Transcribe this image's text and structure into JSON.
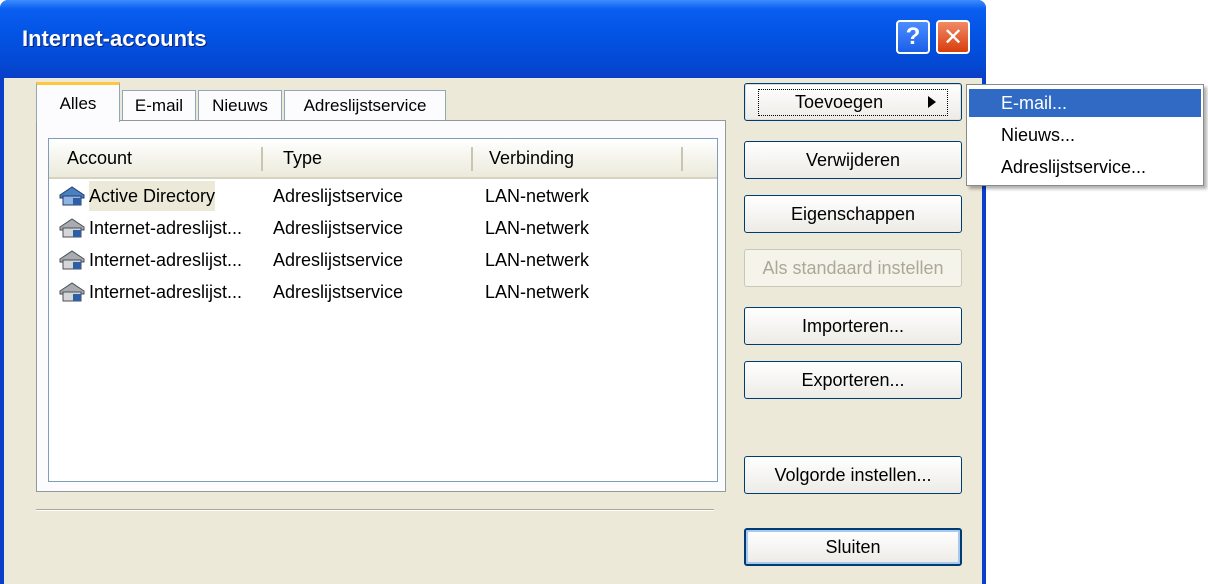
{
  "window": {
    "title": "Internet-accounts",
    "help_glyph": "?",
    "close_glyph": "✕"
  },
  "tabs": [
    {
      "label": "Alles",
      "active": true
    },
    {
      "label": "E-mail",
      "active": false
    },
    {
      "label": "Nieuws",
      "active": false
    },
    {
      "label": "Adreslijstservice",
      "active": false
    }
  ],
  "list": {
    "columns": [
      "Account",
      "Type",
      "Verbinding"
    ],
    "rows": [
      {
        "account": "Active Directory",
        "type": "Adreslijstservice",
        "connection": "LAN-netwerk",
        "icon": "directory-icon"
      },
      {
        "account": "Internet-adreslijst...",
        "type": "Adreslijstservice",
        "connection": "LAN-netwerk",
        "icon": "directory-icon"
      },
      {
        "account": "Internet-adreslijst...",
        "type": "Adreslijstservice",
        "connection": "LAN-netwerk",
        "icon": "directory-icon"
      },
      {
        "account": "Internet-adreslijst...",
        "type": "Adreslijstservice",
        "connection": "LAN-netwerk",
        "icon": "directory-icon"
      }
    ]
  },
  "buttons": {
    "add": "Toevoegen",
    "remove": "Verwijderen",
    "properties": "Eigenschappen",
    "set_default": "Als standaard instellen",
    "import": "Importeren...",
    "export": "Exporteren...",
    "order": "Volgorde instellen...",
    "close": "Sluiten"
  },
  "submenu": [
    "E-mail...",
    "Nieuws...",
    "Adreslijstservice..."
  ],
  "colors": {
    "title_bar": "#0355e6",
    "face": "#ece9d8",
    "highlight": "#316ac5",
    "tab_accent": "#ffc73c"
  }
}
